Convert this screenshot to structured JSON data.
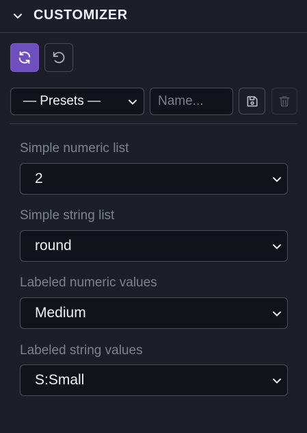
{
  "header": {
    "title": "CUSTOMIZER",
    "chevron_icon": "chevron-down-icon"
  },
  "toolbar": {
    "refresh_icon": "refresh-icon",
    "reset_icon": "undo-icon",
    "accent_color": "#6f4fbd"
  },
  "presets": {
    "selected": "— Presets —",
    "name_placeholder": "Name...",
    "name_value": "",
    "save_icon": "save-icon",
    "delete_icon": "trash-icon"
  },
  "fields": [
    {
      "label": "Simple numeric list",
      "value": "2"
    },
    {
      "label": "Simple string list",
      "value": "round"
    },
    {
      "label": "Labeled numeric values",
      "value": "Medium"
    },
    {
      "label": "Labeled string values",
      "value": "S:Small"
    }
  ]
}
